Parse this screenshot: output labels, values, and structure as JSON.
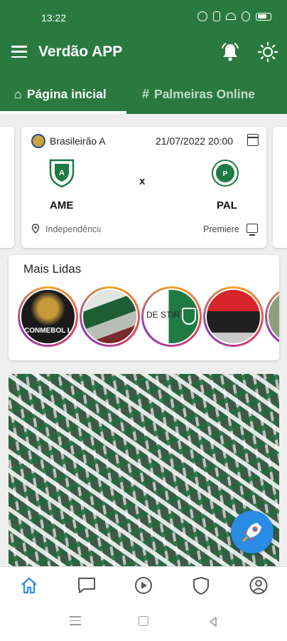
{
  "status_bar": {
    "time": "13:22"
  },
  "app": {
    "title": "Verdão APP"
  },
  "tabs": [
    {
      "label": "Página inicial",
      "glyph": "⌂"
    },
    {
      "label": "Palmeiras Online",
      "glyph": "#"
    }
  ],
  "match": {
    "competition": "Brasileirão A",
    "date": "21/07/2022 20:00",
    "home_team": "AME",
    "away_team": "PAL",
    "separator": "x",
    "stadium": "Independência",
    "broadcaster": "Premiere"
  },
  "mais_lidas": {
    "title": "Mais Lidas",
    "stories": [
      {
        "text": "CONMEBOL LIBERTADORES"
      },
      {
        "text": ""
      },
      {
        "text": "DE STIR"
      },
      {
        "text": ""
      },
      {
        "text": ""
      }
    ]
  },
  "colors": {
    "brand_green": "#2a7a3f",
    "fab_blue": "#2b8ce6",
    "active_nav": "#2b8ce6",
    "inactive_nav": "#555555"
  },
  "bottom_nav": [
    {
      "icon": "home-icon",
      "active": true
    },
    {
      "icon": "chat-icon",
      "active": false
    },
    {
      "icon": "play-icon",
      "active": false
    },
    {
      "icon": "shield-icon",
      "active": false
    },
    {
      "icon": "profile-icon",
      "active": false
    }
  ]
}
